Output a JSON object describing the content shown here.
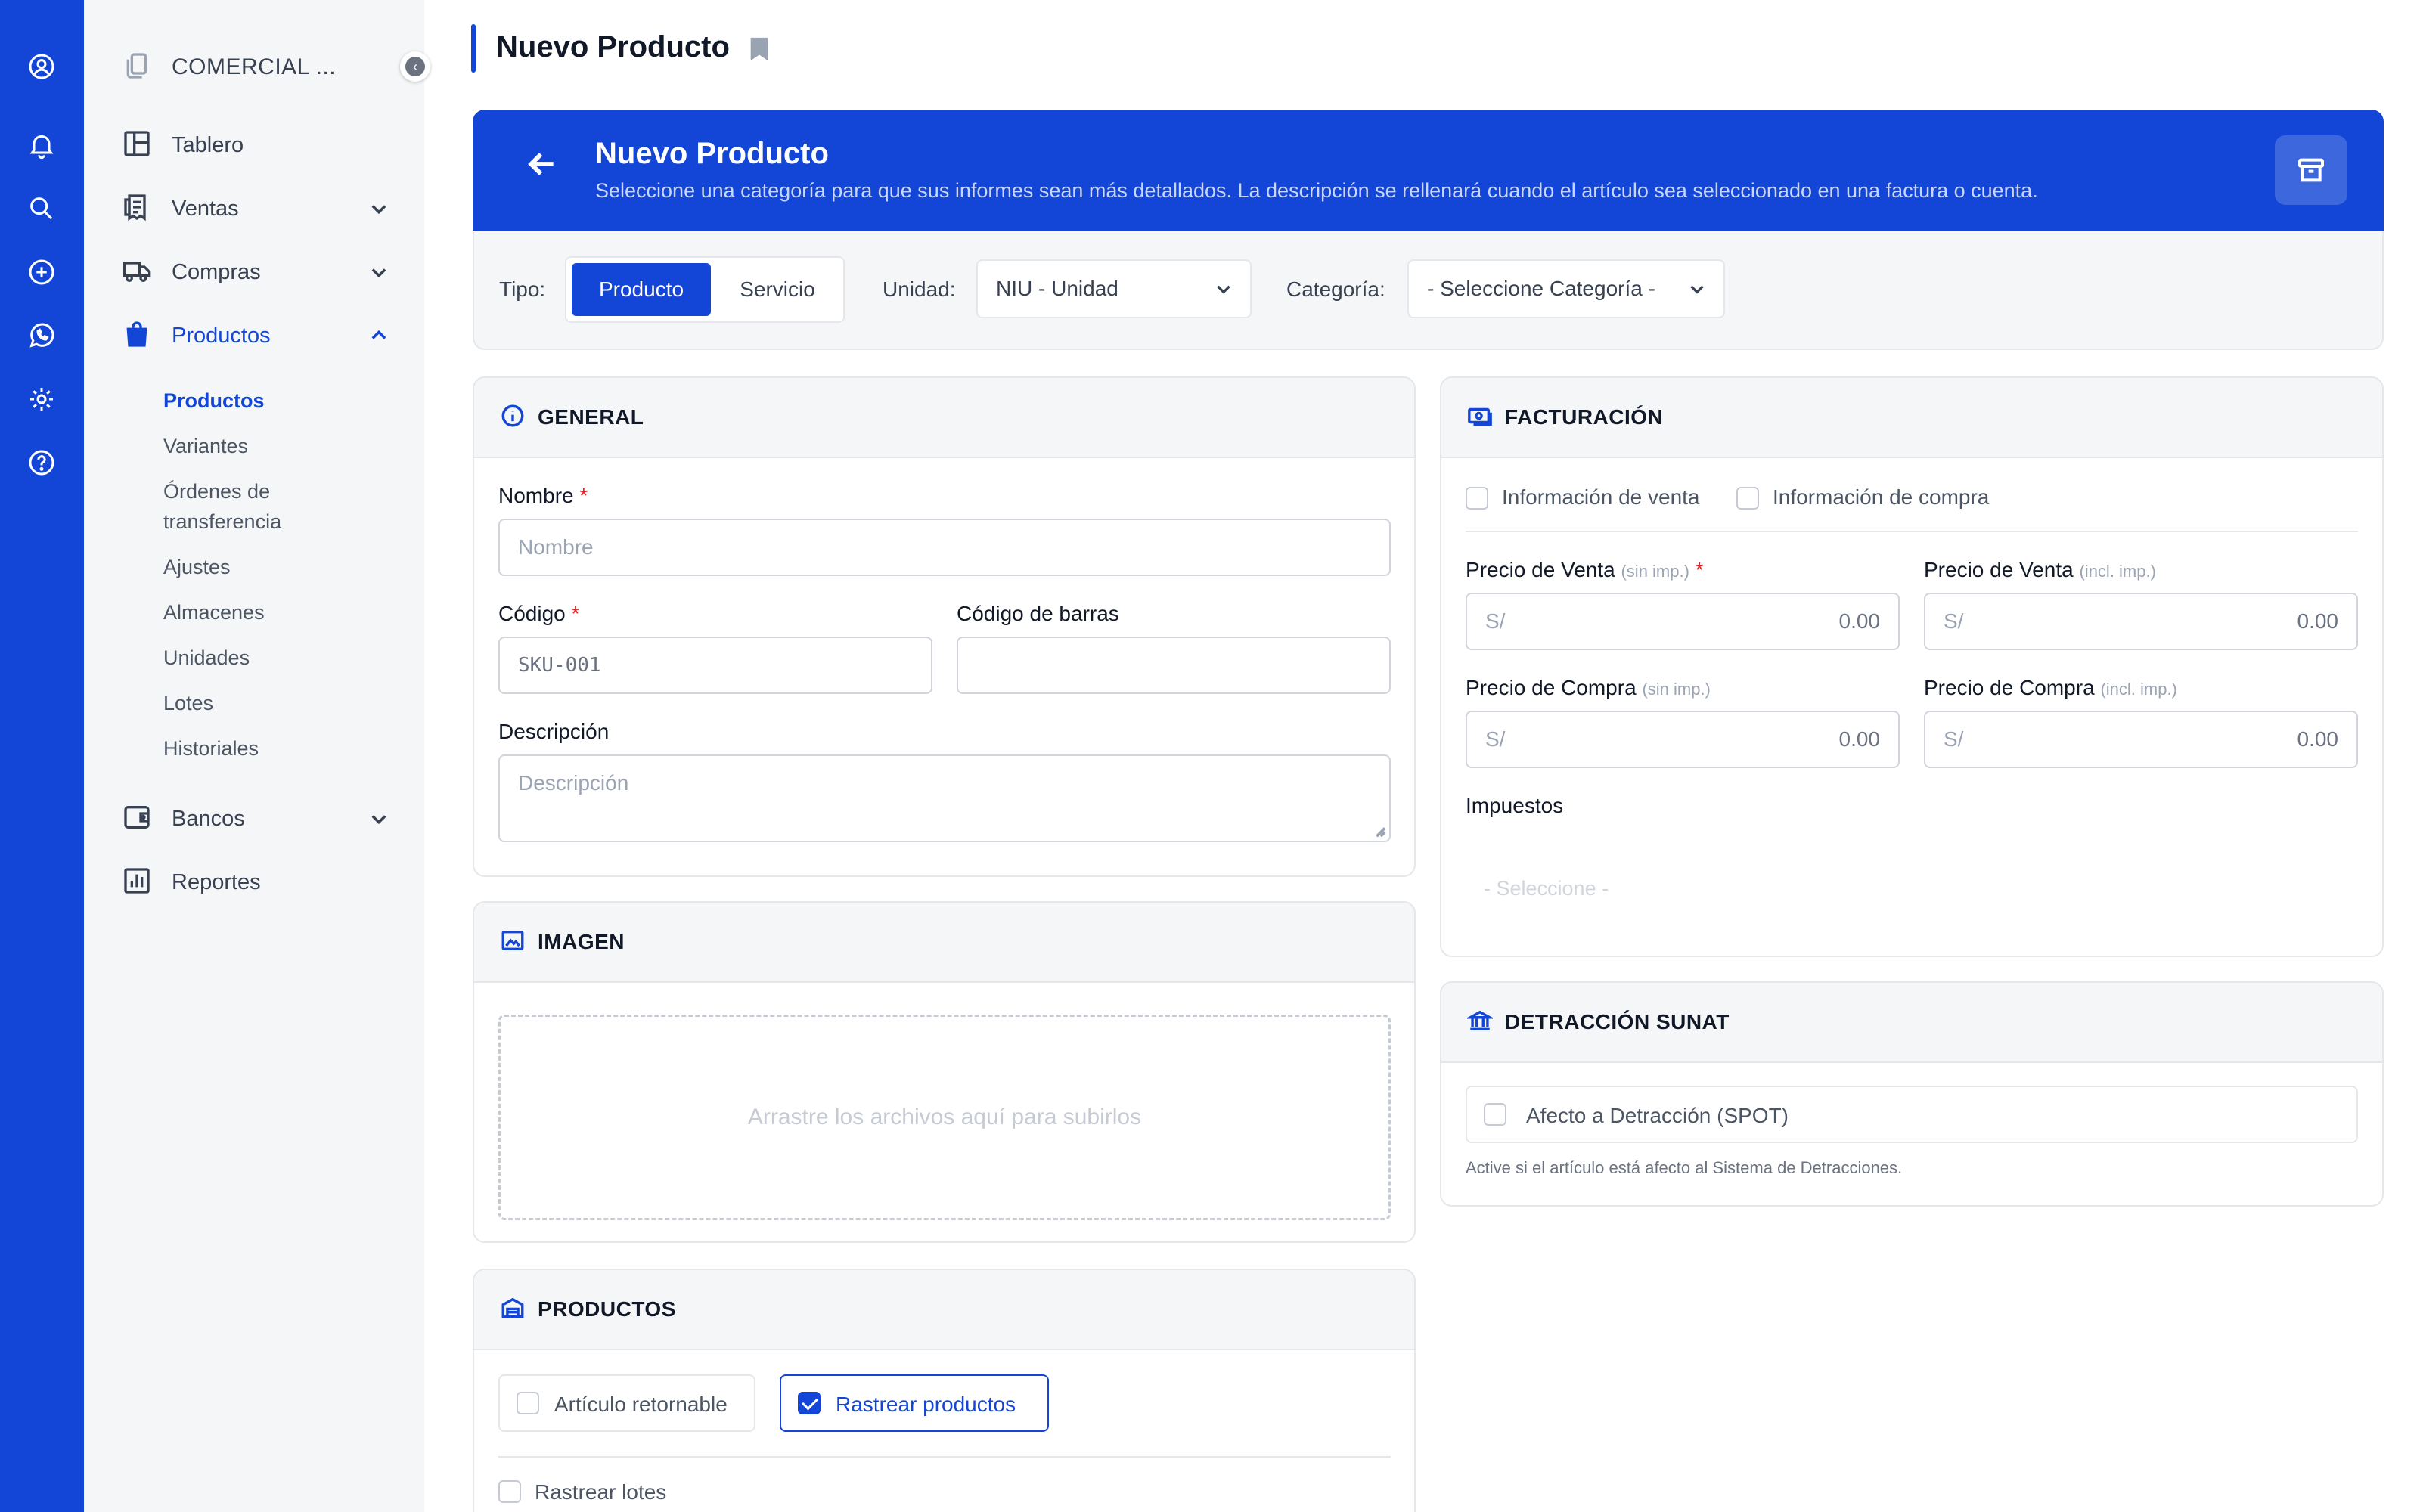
{
  "sidebar": {
    "org_name": "COMERCIAL ...",
    "collapse_glyph": "‹",
    "nav": [
      {
        "label": "Tablero",
        "icon": "dashboard-icon"
      },
      {
        "label": "Ventas",
        "icon": "receipt-icon"
      },
      {
        "label": "Compras",
        "icon": "truck-icon"
      },
      {
        "label": "Productos",
        "icon": "shopping-bag-icon"
      },
      {
        "label": "Bancos",
        "icon": "wallet-icon"
      },
      {
        "label": "Reportes",
        "icon": "chart-icon"
      }
    ],
    "products_sub": [
      "Productos",
      "Variantes",
      "Órdenes de",
      "transferencia",
      "Ajustes",
      "Almacenes",
      "Unidades",
      "Lotes",
      "Historiales"
    ]
  },
  "page": {
    "title": "Nuevo Producto"
  },
  "hero": {
    "title": "Nuevo Producto",
    "description": "Seleccione una categoría para que sus informes sean más detallados. La descripción se rellenará cuando el artículo sea seleccionado en una factura o cuenta."
  },
  "type_bar": {
    "tipo_label": "Tipo:",
    "tipo_options": [
      "Producto",
      "Servicio"
    ],
    "tipo_selected": "Producto",
    "unidad_label": "Unidad:",
    "unidad_value": "NIU - Unidad",
    "categoria_label": "Categoría:",
    "categoria_value": "- Seleccione Categoría -"
  },
  "general": {
    "title": "GENERAL",
    "nombre_label": "Nombre",
    "nombre_placeholder": "Nombre",
    "codigo_label": "Código",
    "codigo_value": "SKU-001",
    "barras_label": "Código de barras",
    "barras_value": "",
    "descripcion_label": "Descripción",
    "descripcion_placeholder": "Descripción",
    "required_mark": "*"
  },
  "imagen": {
    "title": "IMAGEN",
    "dropzone_text": "Arrastre los archivos aquí para subirlos"
  },
  "productos": {
    "title": "PRODUCTOS",
    "retornable_label": "Artículo retornable",
    "retornable_checked": false,
    "rastrear_productos_label": "Rastrear productos",
    "rastrear_productos_checked": true,
    "rastrear_lotes_label": "Rastrear lotes",
    "rastrear_lotes_checked": false
  },
  "facturacion": {
    "title": "FACTURACIÓN",
    "info_venta_label": "Información de venta",
    "info_compra_label": "Información de compra",
    "precio_venta_label": "Precio de Venta",
    "sin_imp": "(sin imp.)",
    "incl_imp": "(incl. imp.)",
    "precio_compra_label": "Precio de Compra",
    "currency": "S/",
    "precio_venta_sin": "0.00",
    "precio_venta_incl": "0.00",
    "precio_compra_sin": "0.00",
    "precio_compra_incl": "0.00",
    "impuestos_label": "Impuestos",
    "impuestos_placeholder": "- Seleccione -"
  },
  "detraccion": {
    "title": "DETRACCIÓN SUNAT",
    "afecto_label": "Afecto a Detracción (SPOT)",
    "help_text": "Active si el artículo está afecto al Sistema de Detracciones."
  },
  "colors": {
    "accent": "#1346d6",
    "sidebar_bg": "#f5f6f7"
  }
}
